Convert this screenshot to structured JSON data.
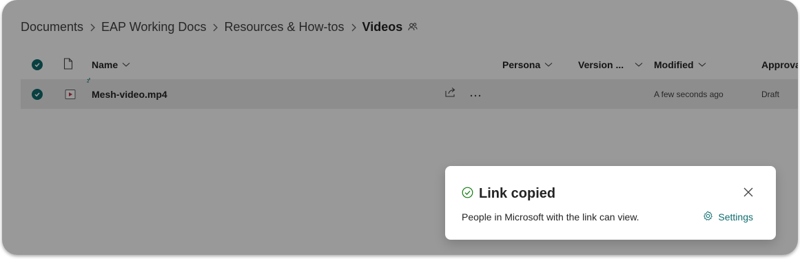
{
  "breadcrumb": {
    "items": [
      "Documents",
      "EAP Working Docs",
      "Resources & How-tos"
    ],
    "current": "Videos"
  },
  "list": {
    "columns": {
      "name": "Name",
      "persona": "Persona",
      "version": "Version ...",
      "modified": "Modified",
      "approval": "Approva"
    },
    "rows": [
      {
        "name": "Mesh-video.mp4",
        "modified": "A few seconds ago",
        "approval": "Draft"
      }
    ]
  },
  "toast": {
    "title": "Link copied",
    "message": "People in Microsoft with the link can view.",
    "settings_label": "Settings"
  },
  "colors": {
    "accent": "#0f6c6e",
    "dim_overlay": "rgba(0,0,0,0.4)"
  },
  "icons": [
    "chevron-right-icon",
    "shared-people-icon",
    "check-circle-icon",
    "file-icon",
    "video-file-icon",
    "share-icon",
    "more-icon",
    "check-success-icon",
    "close-icon",
    "gear-icon"
  ]
}
